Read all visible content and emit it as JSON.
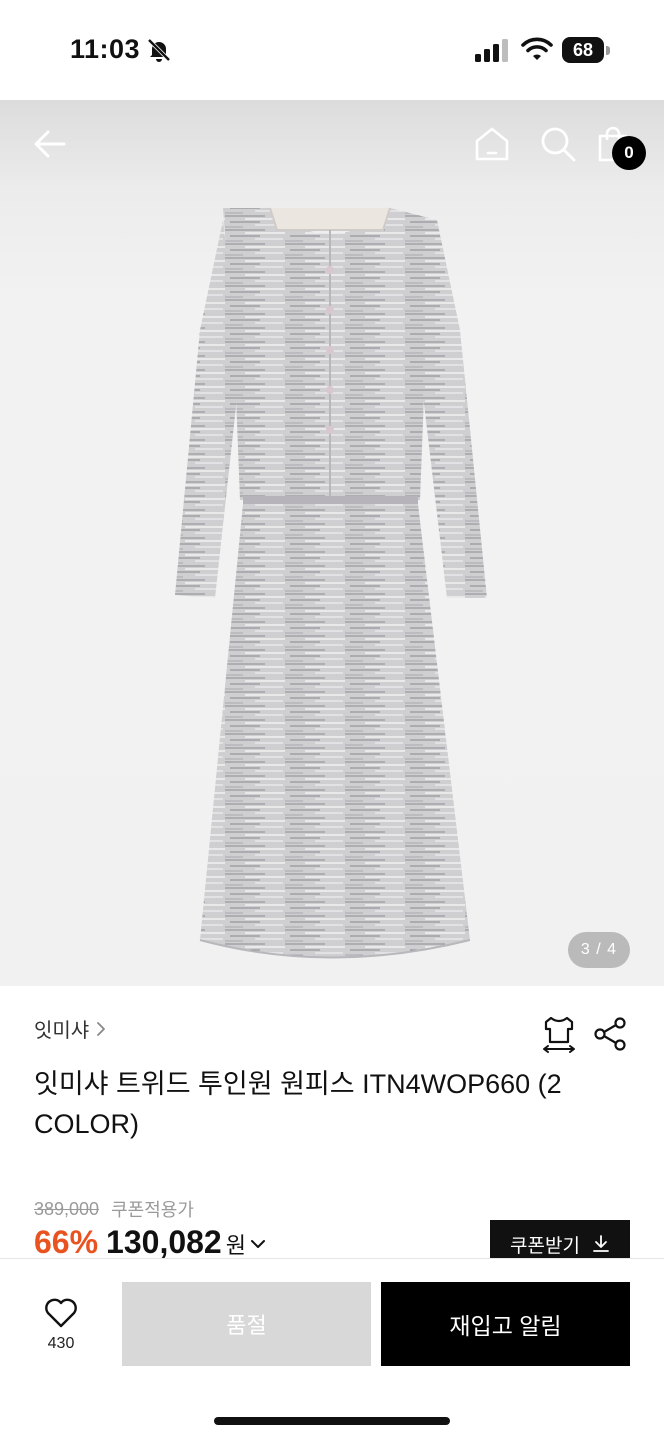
{
  "status_bar": {
    "time": "11:03",
    "battery": "68"
  },
  "header": {
    "cart_count": "0"
  },
  "gallery": {
    "page_indicator": "3 / 4"
  },
  "product": {
    "brand": "잇미샤",
    "title": "잇미샤 트위드 투인원 원피스 ITN4WOP660 (2 COLOR)",
    "original_price": "389,000",
    "coupon_label": "쿠폰적용가",
    "discount": "66%",
    "price": "130,082",
    "currency": "원",
    "coupon_button": "쿠폰받기"
  },
  "bottom_bar": {
    "like_count": "430",
    "soldout_label": "품절",
    "restock_label": "재입고 알림"
  },
  "colors": {
    "accent": "#e8531f",
    "primary": "#000000",
    "disabled": "#d8d8d8"
  }
}
